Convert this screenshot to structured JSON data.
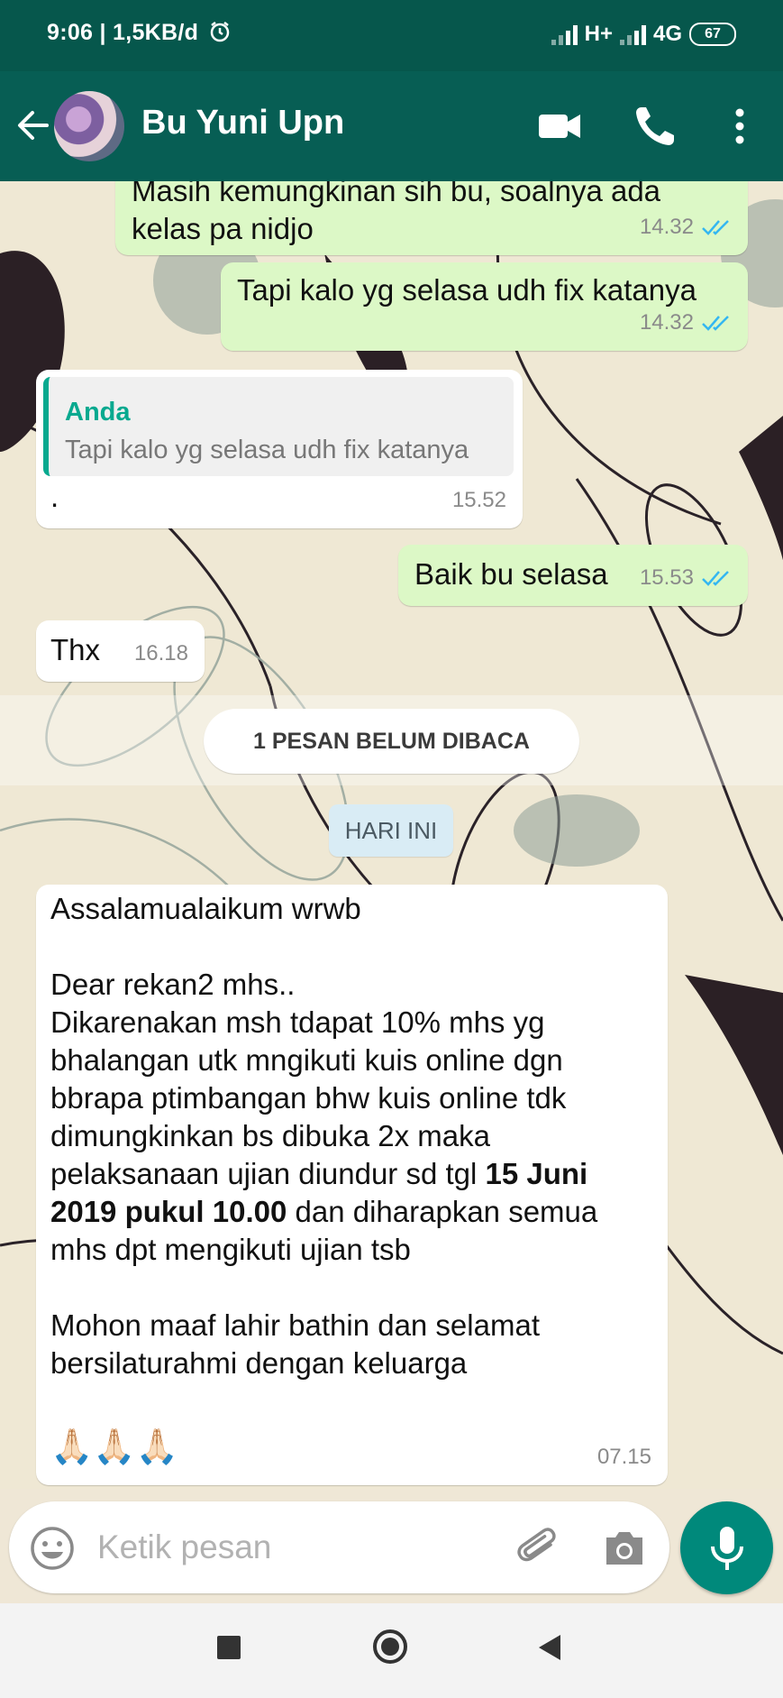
{
  "status_bar": {
    "time_speed": "9:06 | 1,5KB/d",
    "network_1": "H+",
    "network_2": "4G",
    "battery": "67"
  },
  "header": {
    "contact_name": "Bu Yuni Upn"
  },
  "messages": [
    {
      "text_line1": "Masih kemungkinan sih bu, soalnya ada",
      "text_line2": "kelas pa nidjo",
      "time": "14.32"
    },
    {
      "text": "Tapi kalo yg selasa udh fix katanya",
      "time": "14.32"
    },
    {
      "quote_author": "Anda",
      "quote_text": "Tapi kalo yg selasa udh fix katanya",
      "text": ".",
      "time": "15.52"
    },
    {
      "text": "Baik bu selasa",
      "time": "15.53"
    },
    {
      "text": "Thx",
      "time": "16.18"
    }
  ],
  "unread_banner": "1 PESAN BELUM DIBACA",
  "day_label": "HARI INI",
  "announcement": {
    "greeting": "Assalamualaikum wrwb",
    "salutation": "Dear rekan2 mhs..",
    "body_1": "Dikarenakan msh tdapat 10% mhs yg bhalangan utk mngikuti kuis online dgn bbrapa ptimbangan bhw kuis online tdk dimungkinkan bs dibuka 2x maka pelaksanaan ujian diundur sd tgl",
    "body_bold": "15 Juni 2019 pukul 10.00",
    "body_2": "dan diharapkan semua mhs dpt mengikuti ujian tsb",
    "closing": "Mohon maaf lahir bathin dan selamat bersilaturahmi dengan keluarga",
    "emoji": "🙏🏻🙏🏻🙏🏻",
    "time": "07.15"
  },
  "input": {
    "placeholder": "Ketik pesan"
  },
  "colors": {
    "header": "#075e54",
    "status_bar": "#06574c",
    "outgoing_bubble": "#dcf8c6",
    "incoming_bubble": "#ffffff",
    "accent": "#00897b",
    "read_ticks": "#34b7f1"
  }
}
